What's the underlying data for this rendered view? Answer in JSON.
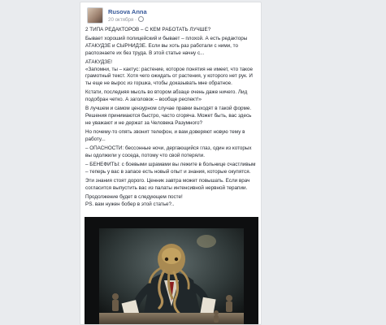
{
  "post": {
    "author": "Rusova Anna",
    "date": "20 октября · ",
    "paragraphs": [
      "2 ТИПА РЕДАКТОРОВ – С КЕМ РАБОТАТЬ ЛУЧШЕ?",
      "Бывает хороший полицейский и бывает – плохой. А есть редакторы АТАКУДЗЕ и СЫРНИДЗЕ. Если вы хоть раз работали с ними, то распознаете их без труда. В этой статье начну с...",
      "АТАКУДЗЕ!\n«Запомни, ты – кактус: растение, которое понятия не имеет, что такое грамотный текст. Хотя чего ожидать от растения, у которого нет рук. И ты еще не вырос из горшка, чтобы доказывать мне обратное.",
      "Кстати, последняя мысль во втором абзаце очень даже ничего. Лид подобран четко. А заголовок – вообще респект!»",
      "В лучшем и самом цензурном случае правки выходят в такой форме. Решения принимаются быстро, часто сгоряча. Может быть, вас здесь не уважают и не держат за Человека Разумного?",
      "Но почему-то опять звонит телефон, и вам доверяют новую тему в работу...",
      "– ОПАСНОСТИ: бессонные ночи, дергающийся глаз, один из которых вы одолжили у соседа, потому что свой потеряли.",
      "– БЕНЕФИТЫ: с боевыми шрамами вы лежите в больнице счастливым – теперь у вас в запасе есть новый опыт и знания, которые окупятся.",
      "Эти знания стоят дорого. Ценник завтра может повышать. Если врач согласится выпустить вас из палаты интенсивной нервной терапии.",
      "Продолжение будет в следующем посте!\nPS. вам нужен бобер в этой статье?.."
    ]
  },
  "colors": {
    "background": "#e9ebee",
    "author_link": "#365899",
    "muted": "#90949c",
    "text": "#1d2129"
  },
  "icons": {
    "privacy": "globe-icon"
  }
}
